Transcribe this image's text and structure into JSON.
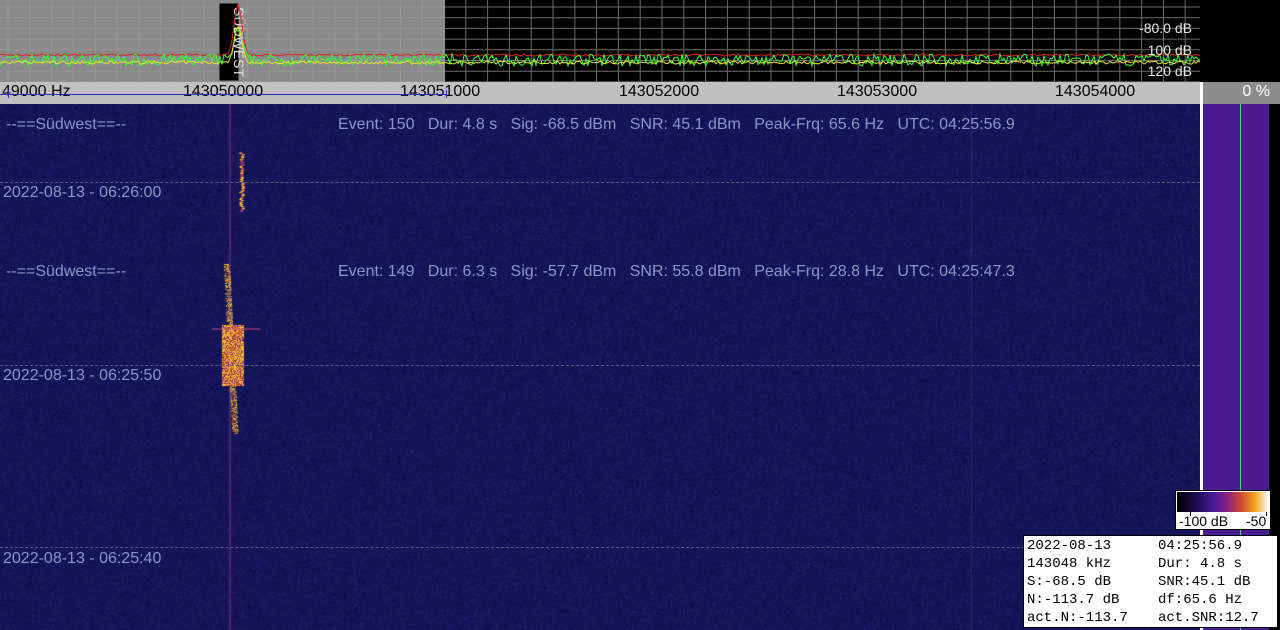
{
  "spectrum": {
    "db_labels": [
      "-80.0 dB",
      "100 dB",
      "120 dB"
    ],
    "station_label": "SÜDWEST"
  },
  "freq_axis": {
    "ticks": [
      "49000 Hz",
      "143050000",
      "143051000",
      "143052000",
      "143053000",
      "143054000"
    ],
    "percent": "0 %"
  },
  "waterfall": {
    "events": [
      {
        "station": "--==Südwest==--",
        "event": "Event: 150",
        "dur": "Dur: 4.8 s",
        "sig": "Sig: -68.5 dBm",
        "snr": "SNR: 45.1 dBm",
        "peak": "Peak-Frq: 65.6 Hz",
        "utc": "UTC: 04:25:56.9"
      },
      {
        "station": "--==Südwest==--",
        "event": "Event: 149",
        "dur": "Dur: 6.3 s",
        "sig": "Sig: -57.7 dBm",
        "snr": "SNR: 55.8 dBm",
        "peak": "Peak-Frq: 28.8 Hz",
        "utc": "UTC: 04:25:47.3"
      }
    ],
    "timestamps": [
      "2022-08-13 - 06:26:00",
      "2022-08-13 - 06:25:50",
      "2022-08-13 - 06:25:40"
    ]
  },
  "colorbar": {
    "min_label": "-100 dB",
    "max_label": "-50"
  },
  "info": {
    "rows": [
      [
        "2022-08-13",
        "04:25:56.9"
      ],
      [
        "143048 kHz",
        "Dur: 4.8 s"
      ],
      [
        "S:-68.5 dB",
        "SNR:45.1 dB"
      ],
      [
        "N:-113.7 dB",
        "df:65.6 Hz"
      ],
      [
        "act.N:-113.7",
        "act.SNR:12.7"
      ]
    ]
  },
  "colors": {
    "waterfall_bg": "#15155a",
    "trace_green": "#33ff33",
    "trace_red": "#e02020",
    "trace_yellow": "#e8e830",
    "text_label": "#8a97c8"
  }
}
